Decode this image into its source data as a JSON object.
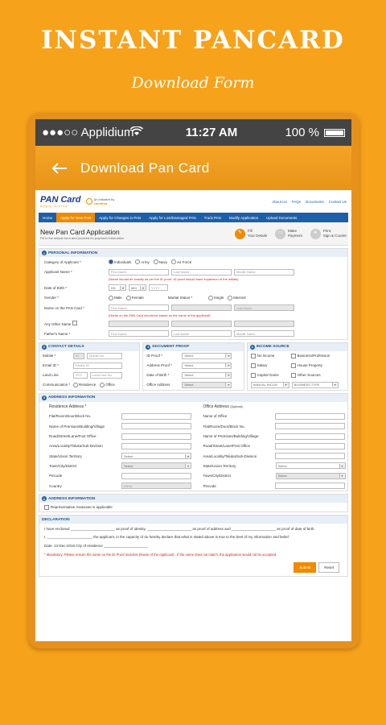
{
  "promo": {
    "title": "INSTANT PANCARD",
    "subtitle": "Download Form"
  },
  "statusbar": {
    "carrier": "●●●○○ Applidium",
    "time": "11:27 AM",
    "battery": "100 %"
  },
  "appbar": {
    "title": "Download Pan Card"
  },
  "site": {
    "logo_main": "PAN Card",
    "logo_sub": "Apply Online",
    "partner_text": "An initiative by",
    "partner_name": "cmudhra",
    "top_links": [
      "About Us",
      "FAQs",
      "Documents",
      "Contact Us"
    ],
    "nav": [
      "Home",
      "Apply for New PAN",
      "Apply for Changes in PAN",
      "Apply for Lost/Damaged PAN",
      "Track PAN",
      "Modify Application",
      "Upload Documents"
    ],
    "active_nav": 1
  },
  "application": {
    "title": "New Pan Card Application",
    "subtitle": "Fill in the simple form and proceed for payment information",
    "steps": [
      {
        "line1": "Fill",
        "line2": "Your Details",
        "icon": "pencil-icon"
      },
      {
        "line1": "Make",
        "line2": "Payment",
        "icon": "card-icon"
      },
      {
        "line1": "Print,",
        "line2": "Sign & Courier",
        "icon": "send-icon"
      }
    ]
  },
  "personal": {
    "header": "PERSONAL INFORMATION",
    "category_label": "Category of Applicant *",
    "categories": [
      "Individuals",
      "Army",
      "Navy",
      "Air Force"
    ],
    "name_label": "Applicant Name *",
    "first_ph": "First Name",
    "last_ph": "Last Name",
    "middle_ph": "Middle Name",
    "name_note": "(Name should be exactly as per the ID proof. ID proof should have expansion of the initials)",
    "dob_label": "Date of Birth *",
    "dd": "DD",
    "mm": "MM",
    "yyyy": "YYYY",
    "gender_label": "Gender *",
    "genders": [
      "Male",
      "Female"
    ],
    "marital_label": "Marital Status *",
    "maritals": [
      "Single",
      "Married"
    ],
    "pan_name_label": "Name on the PAN Card *",
    "pan_first_ph": "First Name",
    "pan_last_ph": "Last Name",
    "pan_note": "(Name on the PAN Card should be based on the name of the applicant)",
    "other_name_label": "Any Other Name",
    "father_label": "Father's Name *",
    "f_first_ph": "First Name",
    "f_last_ph": "Last Name",
    "f_middle_ph": "Middle Name"
  },
  "contact": {
    "header": "CONTACT DETAILS",
    "mobile_label": "Mobile *",
    "mobile_code": "91",
    "mobile_ph": "Mobile No",
    "email_label": "Email ID *",
    "email_ph": "EMAIL ID",
    "landline_label": "Land Line",
    "std_ph": "STD",
    "landline_ph": "Land Line No",
    "comm_label": "Communication *",
    "comm_options": [
      "Residence",
      "Office"
    ]
  },
  "docs": {
    "header": "DOCUMENT PROOF",
    "rows": [
      {
        "label": "ID Proof *",
        "value": "Select"
      },
      {
        "label": "Address Proof *",
        "value": "Select"
      },
      {
        "label": "Date of Birth *",
        "value": "Select"
      },
      {
        "label": "Office Address",
        "value": "Select"
      }
    ]
  },
  "income": {
    "header": "INCOME SOURCE",
    "left": [
      "No Income",
      "Salary",
      "Capital Gains"
    ],
    "right": [
      "Business/Profession",
      "House Property",
      "Other Sources"
    ],
    "annual": "ANNUAL INCON",
    "business": "BUSINESS TYPE"
  },
  "address": {
    "header": "ADDRESS INFORMATION",
    "res_title": "Residence Address *",
    "off_title": "Office Address",
    "off_optional": "(Optional)",
    "res_fields": [
      "Flat/Room/Door/Block No.",
      "Name of Premises/Building/Village",
      "Road/Street/Lane/Post Office",
      "Area/Locality/Taluka/Sub-Division",
      "State/Union Territory",
      "Town/City/District",
      "Pincode",
      "Country"
    ],
    "off_fields": [
      "Name of Office",
      "Flat/Room/Door/Block No.",
      "Name of Premises/Building/Village",
      "Road/Street/Lane/Post Office",
      "Area/Locality/Taluka/Sub-Division",
      "State/Union Territory",
      "Town/City/District",
      "Pincode"
    ],
    "select": "Select",
    "country_value": "INDIA"
  },
  "address2": {
    "header": "ADDRESS INFORMATION",
    "rep_label": "Representative Assessee is applicable"
  },
  "declaration": {
    "header": "DECLARATION",
    "line1a": "I have enclosed ______________________ as proof of identity, ______________________ as proof of address and ______________________ as proof of date of birth.",
    "line2": "I, ______________________, the applicant, in the capacity of do hereby declare that what is stated above is true to the best of my information and belief.",
    "line3": "Date: 13-Dec-2016      City of residence ______________________",
    "note": "* Mandatory: Please ensure the name on the ID Proof matches  (Name of the Applicant) . If the name does not match, the application would not be accepted.",
    "submit": "Submit",
    "reset": "Reset"
  }
}
